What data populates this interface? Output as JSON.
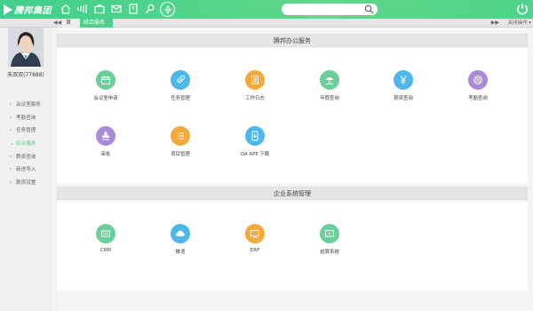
{
  "header": {
    "logo_text": "腾邦集团",
    "search": {
      "placeholder": ""
    },
    "nav_icons": [
      "home-icon",
      "signal-icon",
      "briefcase-icon",
      "mail-icon",
      "bookmark-icon",
      "tools-icon",
      "globe-icon"
    ],
    "brand_color": "#4fcf8e"
  },
  "tabs": {
    "home_label": "首页",
    "active_label": "综合服务",
    "close_glyph": "×",
    "close_ops_label": "关闭操作",
    "prev_glyph": "◀◀",
    "next_glyph": "▶▶"
  },
  "sidebar": {
    "username": "朱双双(77888)",
    "items": [
      {
        "label": "会议室服务",
        "active": false
      },
      {
        "label": "考勤查询",
        "active": false
      },
      {
        "label": "任务管理",
        "active": false
      },
      {
        "label": "综合服务",
        "active": true
      },
      {
        "label": "薪资查询",
        "active": false
      },
      {
        "label": "新进导入",
        "active": false
      },
      {
        "label": "薪资设置",
        "active": false
      }
    ]
  },
  "sections": [
    {
      "title": "腾邦办公服务",
      "apps": [
        {
          "label": "会议室申请",
          "icon": "calendar-icon",
          "color": "#6ccf9a"
        },
        {
          "label": "任务管理",
          "icon": "paperclip-icon",
          "color": "#4cb7e8"
        },
        {
          "label": "工作日志",
          "icon": "notes-icon",
          "color": "#f5a93a"
        },
        {
          "label": "年假查询",
          "icon": "beach-icon",
          "color": "#6ccf9a"
        },
        {
          "label": "薪资查询",
          "icon": "yen-icon",
          "color": "#4cb7e8"
        },
        {
          "label": "考勤查询",
          "icon": "fingerprint-icon",
          "color": "#a98ad8"
        },
        {
          "label": "审批",
          "icon": "stamp-icon",
          "color": "#a98ad8"
        },
        {
          "label": "项目管理",
          "icon": "list-icon",
          "color": "#f5a93a"
        },
        {
          "label": "OA APP 下载",
          "icon": "phone-icon",
          "color": "#4cb7e8"
        }
      ]
    },
    {
      "title": "企业系统管理",
      "apps": [
        {
          "label": "CRM",
          "icon": "crm-icon",
          "color": "#6ccf9a"
        },
        {
          "label": "帷语",
          "icon": "cloud-icon",
          "color": "#4cb7e8"
        },
        {
          "label": "ERP",
          "icon": "erp-icon",
          "color": "#f5a93a"
        },
        {
          "label": "结算系统",
          "icon": "screen-icon",
          "color": "#6ccf9a"
        }
      ]
    }
  ]
}
